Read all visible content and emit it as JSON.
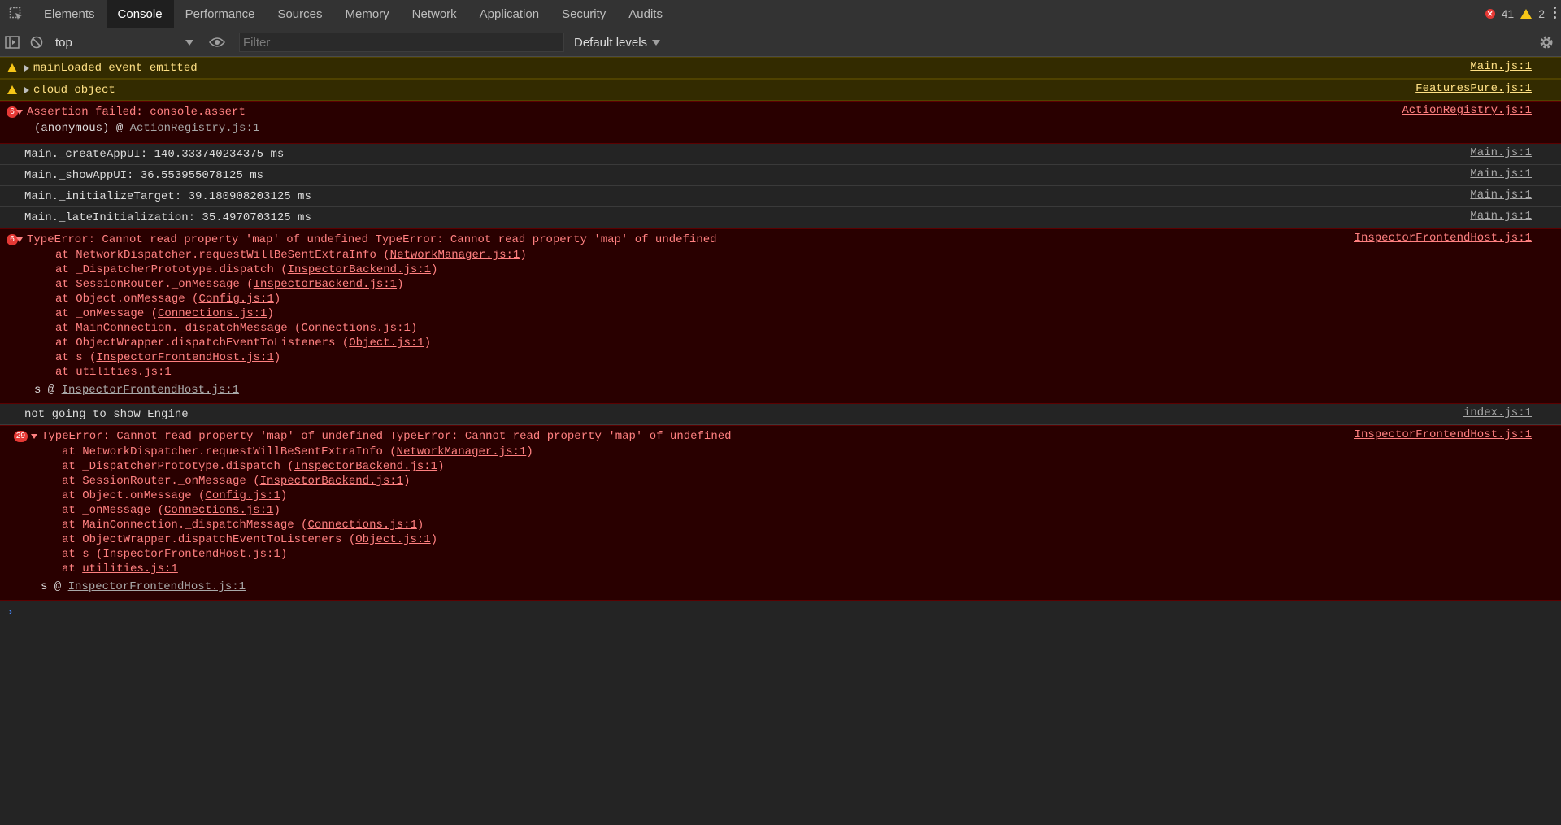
{
  "tabs": [
    "Elements",
    "Console",
    "Performance",
    "Sources",
    "Memory",
    "Network",
    "Application",
    "Security",
    "Audits"
  ],
  "active_tab": "Console",
  "counts": {
    "errors": "41",
    "warnings": "2"
  },
  "toolbar": {
    "context": "top",
    "filter_placeholder": "Filter",
    "levels": "Default levels"
  },
  "messages": {
    "m1": {
      "text": "mainLoaded event emitted",
      "source": "Main.js:1"
    },
    "m2": {
      "text": "cloud object",
      "source": "FeaturesPure.js:1"
    },
    "m3": {
      "count": "6",
      "text": "Assertion failed: console.assert",
      "source": "ActionRegistry.js:1",
      "trace_prefix": "(anonymous) @ ",
      "trace_link": "ActionRegistry.js:1"
    },
    "m4": {
      "text": "Main._createAppUI: 140.333740234375 ms",
      "source": "Main.js:1"
    },
    "m5": {
      "text": "Main._showAppUI: 36.553955078125 ms",
      "source": "Main.js:1"
    },
    "m6": {
      "text": "Main._initializeTarget: 39.180908203125 ms",
      "source": "Main.js:1"
    },
    "m7": {
      "text": "Main._lateInitialization: 35.4970703125 ms",
      "source": "Main.js:1"
    },
    "m8": {
      "count": "6",
      "text": "TypeError: Cannot read property 'map' of undefined TypeError: Cannot read property 'map' of undefined",
      "source": "InspectorFrontendHost.js:1",
      "trace_prefix": "s @ ",
      "trace_link": "InspectorFrontendHost.js:1"
    },
    "m9": {
      "text": "not going to show Engine",
      "source": "index.js:1"
    },
    "m10": {
      "count": "29",
      "text": "TypeError: Cannot read property 'map' of undefined TypeError: Cannot read property 'map' of undefined",
      "source": "InspectorFrontendHost.js:1",
      "trace_prefix": "s @ ",
      "trace_link": "InspectorFrontendHost.js:1"
    }
  },
  "stack_frames": [
    {
      "fn": "at NetworkDispatcher.requestWillBeSentExtraInfo (",
      "file": "NetworkManager.js:1",
      "close": ")"
    },
    {
      "fn": "at _DispatcherPrototype.dispatch (",
      "file": "InspectorBackend.js:1",
      "close": ")"
    },
    {
      "fn": "at SessionRouter._onMessage (",
      "file": "InspectorBackend.js:1",
      "close": ")"
    },
    {
      "fn": "at Object.onMessage (",
      "file": "Config.js:1",
      "close": ")"
    },
    {
      "fn": "at _onMessage (",
      "file": "Connections.js:1",
      "close": ")"
    },
    {
      "fn": "at MainConnection._dispatchMessage (",
      "file": "Connections.js:1",
      "close": ")"
    },
    {
      "fn": "at ObjectWrapper.dispatchEventToListeners (",
      "file": "Object.js:1",
      "close": ")"
    },
    {
      "fn": "at s (",
      "file": "InspectorFrontendHost.js:1",
      "close": ")"
    },
    {
      "fn": "at ",
      "file": "utilities.js:1",
      "close": ""
    }
  ],
  "prompt": "›",
  "colors": {
    "error_bg": "#290000",
    "warn_bg": "#332b00",
    "error_text": "#ff8080",
    "warn_text": "#ffe084",
    "badge": "#e53935"
  }
}
